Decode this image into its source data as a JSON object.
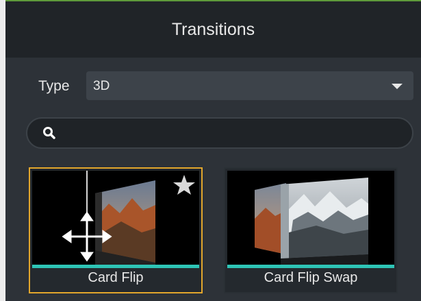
{
  "panel": {
    "title": "Transitions"
  },
  "type_filter": {
    "label": "Type",
    "value": "3D"
  },
  "search": {
    "placeholder": ""
  },
  "transitions": [
    {
      "label": "Card Flip",
      "selected": true,
      "favorite_icon": "star-icon"
    },
    {
      "label": "Card Flip Swap",
      "selected": false
    }
  ],
  "colors": {
    "selected_border": "#e3a72c",
    "accent_bar": "#2ec4b6"
  }
}
